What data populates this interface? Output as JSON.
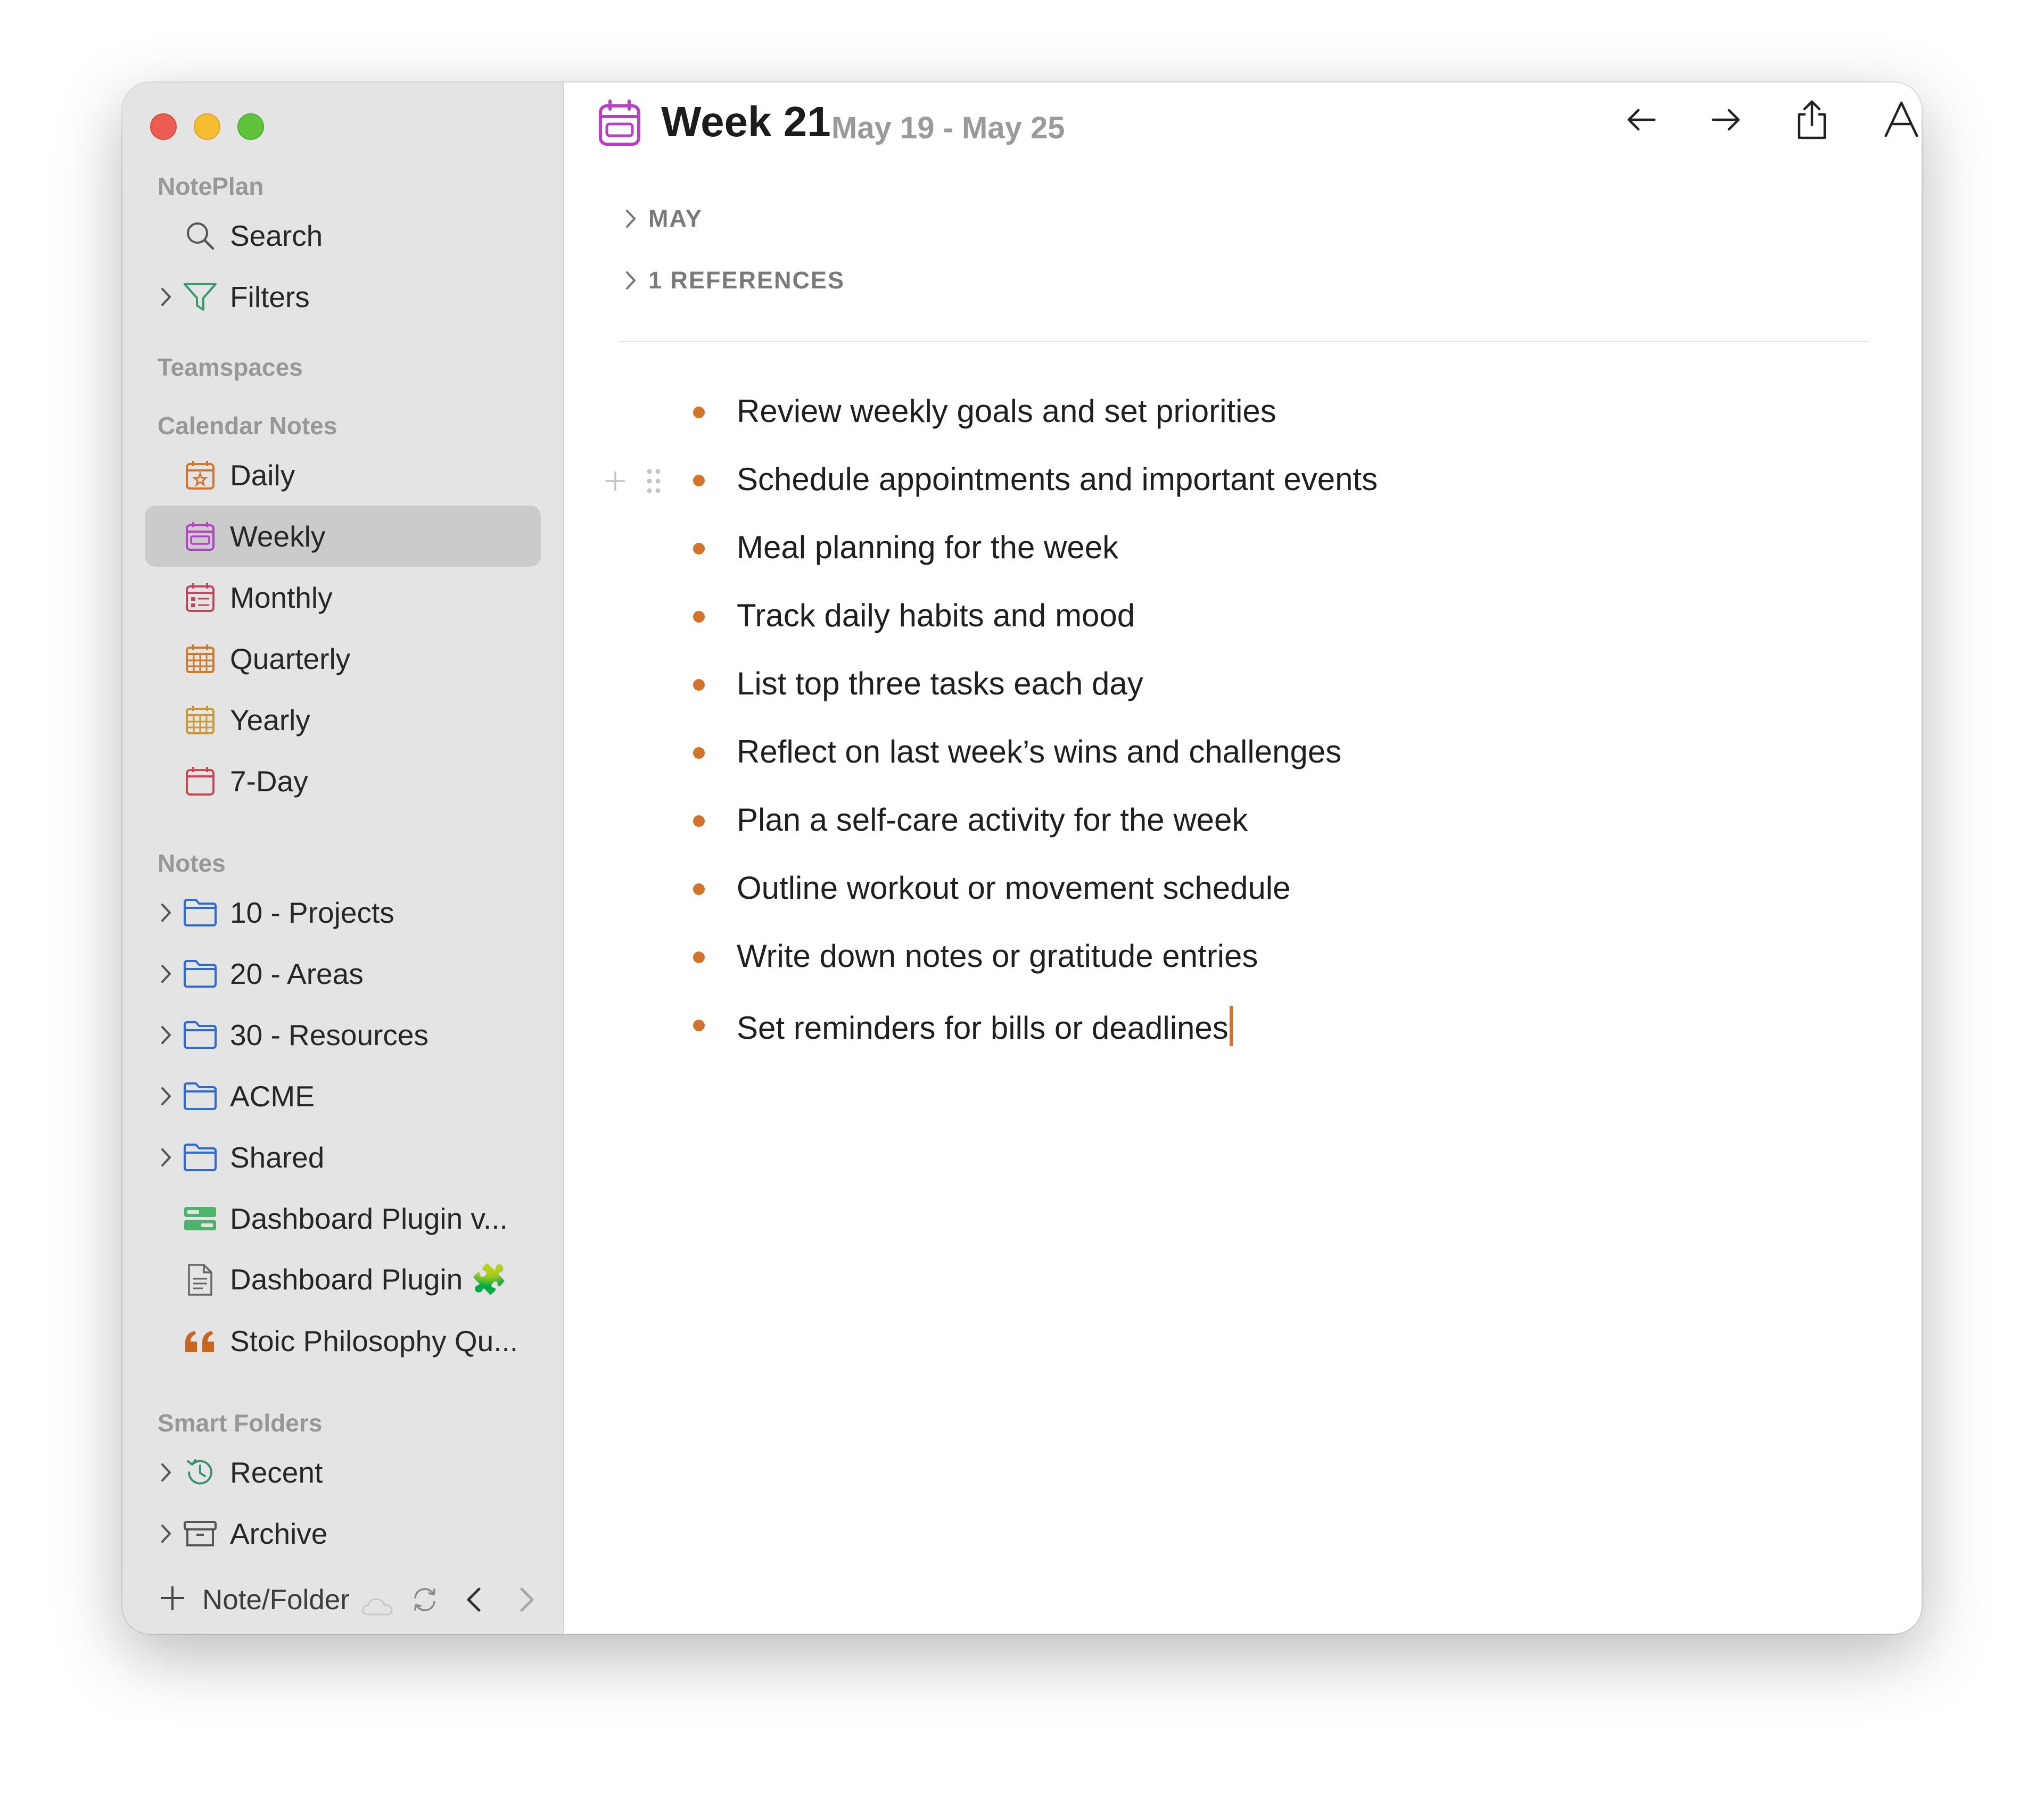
{
  "sidebar": {
    "app_section": "NotePlan",
    "search_label": "Search",
    "filters_label": "Filters",
    "teamspaces_section": "Teamspaces",
    "calendar_section": "Calendar Notes",
    "calendar_items": [
      {
        "label": "Daily",
        "icon": "calendar-star-icon"
      },
      {
        "label": "Weekly",
        "icon": "calendar-week-icon",
        "selected": true
      },
      {
        "label": "Monthly",
        "icon": "calendar-month-icon"
      },
      {
        "label": "Quarterly",
        "icon": "calendar-grid-icon"
      },
      {
        "label": "Yearly",
        "icon": "calendar-grid-icon"
      },
      {
        "label": "7-Day",
        "icon": "calendar-icon"
      }
    ],
    "notes_section": "Notes",
    "folders": [
      "10 - Projects",
      "20 - Areas",
      "30 - Resources",
      "ACME",
      "Shared"
    ],
    "notes": [
      {
        "label": "Dashboard Plugin v...",
        "icon": "dashboard-icon"
      },
      {
        "label": "Dashboard Plugin",
        "icon": "document-icon",
        "emoji": "🧩"
      },
      {
        "label": "Stoic Philosophy Qu...",
        "icon": "quote-icon"
      }
    ],
    "smart_section": "Smart Folders",
    "smart_items": [
      "Recent",
      "Archive"
    ],
    "bottom": {
      "new_label": "Note/Folder"
    }
  },
  "header": {
    "title": "Week 21",
    "date_range": "May 19 - May 25"
  },
  "sections": {
    "month": "MAY",
    "references": "1 REFERENCES"
  },
  "items": [
    "Review weekly goals and set priorities",
    "Schedule appointments and important events",
    "Meal planning for the week",
    "Track daily habits and mood",
    "List top three tasks each day",
    "Reflect on last week’s wins and challenges",
    "Plan a self-care activity for the week",
    "Outline workout or movement schedule",
    "Write down notes or gratitude entries",
    "Set reminders for bills or deadlines"
  ],
  "colors": {
    "accent": "#d2742c",
    "weekly_icon": "#b83fc6",
    "folder_icon": "#2f6bd6",
    "sidebar_bg": "#e4e4e4"
  }
}
